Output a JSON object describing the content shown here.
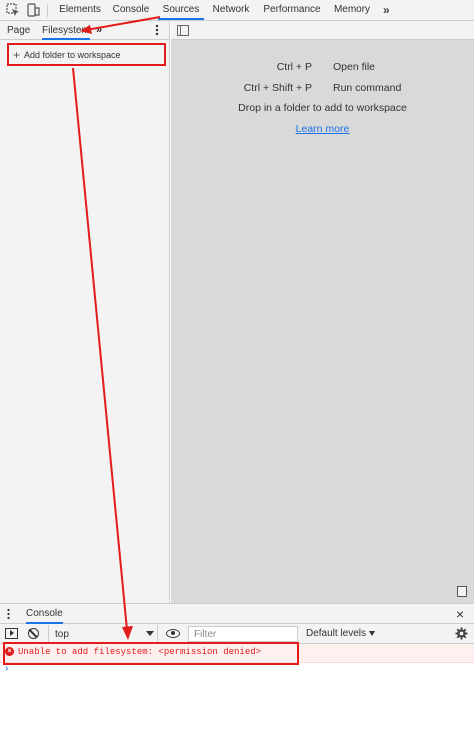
{
  "toolbar": {
    "tabs": [
      "Elements",
      "Console",
      "Sources",
      "Network",
      "Performance",
      "Memory"
    ],
    "active_tab": "Sources",
    "overflow": "»",
    "icons": [
      "inspect-element-icon",
      "device-toolbar-icon",
      "more-tabs-chevron-icon"
    ]
  },
  "navigator": {
    "tabs": [
      "Page",
      "Filesystem"
    ],
    "active_tab": "Filesystem",
    "overflow": "»",
    "add_folder_plus": "+",
    "add_folder_label": "Add folder to workspace"
  },
  "editor": {
    "shortcuts": [
      {
        "keys": "Ctrl + P",
        "action": "Open file"
      },
      {
        "keys": "Ctrl + Shift + P",
        "action": "Run command"
      }
    ],
    "drop_hint": "Drop in a folder to add to workspace",
    "learn_more": "Learn more"
  },
  "drawer": {
    "tab": "Console",
    "close": "×"
  },
  "console": {
    "context": "top",
    "filter_placeholder": "Filter",
    "levels": "Default levels",
    "error_symbol": "×",
    "error_message": "Unable to add filesystem: <permission denied>",
    "prompt": "›"
  },
  "colors": {
    "accent": "#1a73e8",
    "annotation": "#e21b1b",
    "error_text": "#e21b1b",
    "editor_bg": "#d9d9d9",
    "panel_bg": "#f3f3f3"
  }
}
